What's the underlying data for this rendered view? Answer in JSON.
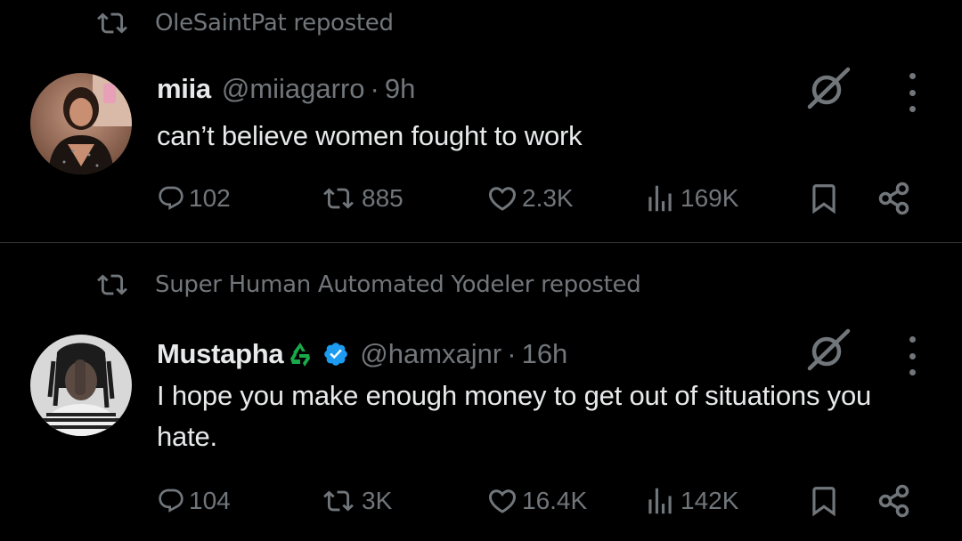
{
  "posts": [
    {
      "repost_label": "OleSaintPat reposted",
      "author": {
        "name": "miia",
        "handle": "@miiagarro",
        "time": "9h",
        "verified": false,
        "emoji": ""
      },
      "text": "can’t believe women fought to work",
      "stats": {
        "replies": "102",
        "reposts": "885",
        "likes": "2.3K",
        "views": "169K"
      }
    },
    {
      "repost_label": "Super Human Automated Yodeler reposted",
      "author": {
        "name": "Mustapha",
        "handle": "@hamxajnr",
        "time": "16h",
        "verified": true,
        "emoji": "recycle-emoji"
      },
      "text": "I hope you make enough money to get out of situations you hate.",
      "stats": {
        "replies": "104",
        "reposts": "3K",
        "likes": "16.4K",
        "views": "142K"
      }
    }
  ],
  "separator": "·",
  "colors": {
    "background": "#000000",
    "text": "#e7e9ea",
    "muted": "#71767b",
    "verified": "#1d9bf0",
    "divider": "#2f3336",
    "recycle": "#19a84a"
  },
  "icons": [
    "repost-icon",
    "reply-icon",
    "like-icon",
    "views-icon",
    "bookmark-icon",
    "share-icon",
    "grok-icon",
    "more-icon",
    "verified-badge-icon"
  ]
}
